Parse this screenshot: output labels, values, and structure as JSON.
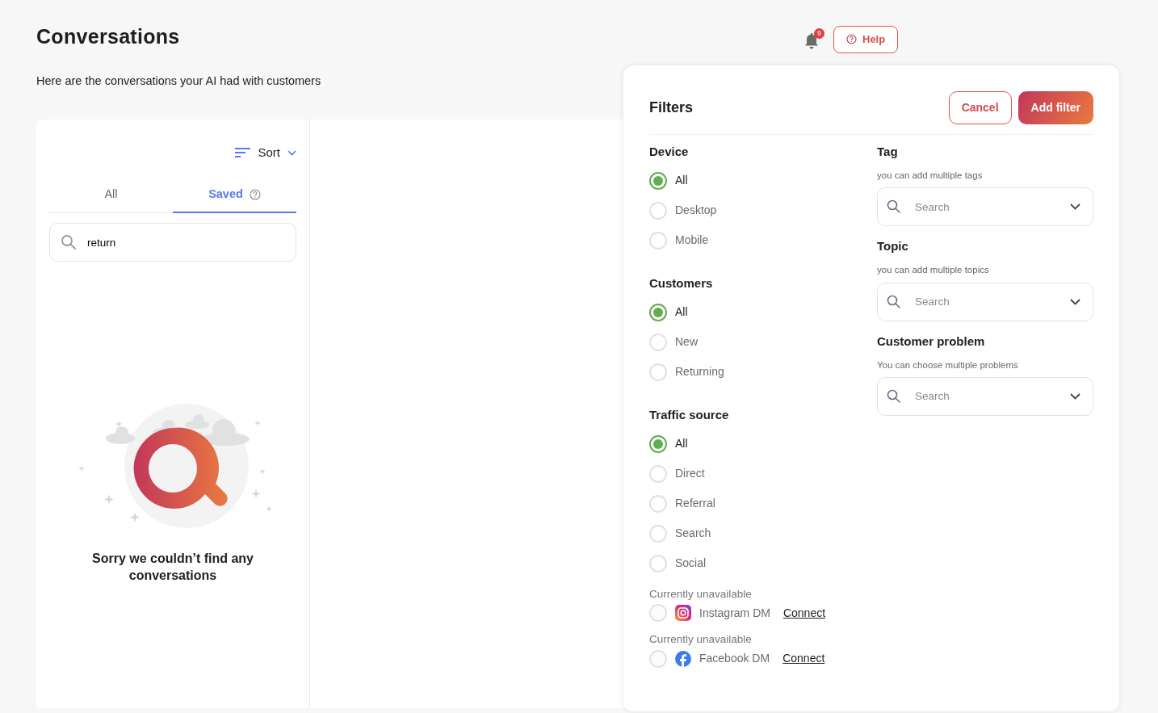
{
  "page": {
    "title": "Conversations",
    "subtitle": "Here are the conversations your AI had with customers"
  },
  "header": {
    "notification_count": "9",
    "help_label": "Help"
  },
  "list_panel": {
    "sort_label": "Sort",
    "tabs": [
      {
        "label": "All",
        "selected": false,
        "has_help": false
      },
      {
        "label": "Saved",
        "selected": true,
        "has_help": true
      }
    ],
    "search": {
      "value": "return"
    },
    "empty_message": "Sorry we couldn’t find any conversations"
  },
  "filters": {
    "title": "Filters",
    "buttons": [
      {
        "label": "Cancel",
        "kind": "outline"
      },
      {
        "label": "Add filter",
        "kind": "primary"
      }
    ],
    "radio_groups": [
      {
        "title": "Device",
        "options": [
          {
            "kind": "radio",
            "label": "All",
            "selected": true
          },
          {
            "kind": "radio",
            "label": "Desktop",
            "selected": false
          },
          {
            "kind": "radio",
            "label": "Mobile",
            "selected": false
          }
        ]
      },
      {
        "title": "Customers",
        "options": [
          {
            "kind": "radio",
            "label": "All",
            "selected": true
          },
          {
            "kind": "radio",
            "label": "New",
            "selected": false
          },
          {
            "kind": "radio",
            "label": "Returning",
            "selected": false
          }
        ]
      },
      {
        "title": "Traffic source",
        "options": [
          {
            "kind": "radio",
            "label": "All",
            "selected": true
          },
          {
            "kind": "radio",
            "label": "Direct",
            "selected": false
          },
          {
            "kind": "radio",
            "label": "Referral",
            "selected": false
          },
          {
            "kind": "radio",
            "label": "Search",
            "selected": false
          },
          {
            "kind": "radio",
            "label": "Social",
            "selected": false
          },
          {
            "kind": "instagram",
            "note": "Currently unavailable",
            "label": "Instagram DM",
            "link": "Connect",
            "selected": false
          },
          {
            "kind": "facebook",
            "note": "Currently unavailable",
            "label": "Facebook DM",
            "link": "Connect",
            "selected": false
          }
        ]
      }
    ],
    "search_fields": [
      {
        "title": "Tag",
        "hint": "you can add multiple tags",
        "placeholder": "Search"
      },
      {
        "title": "Topic",
        "hint": "you can add multiple topics",
        "placeholder": "Search"
      },
      {
        "title": "Customer problem",
        "hint": "You can choose multiple problems",
        "placeholder": "Search"
      }
    ]
  }
}
